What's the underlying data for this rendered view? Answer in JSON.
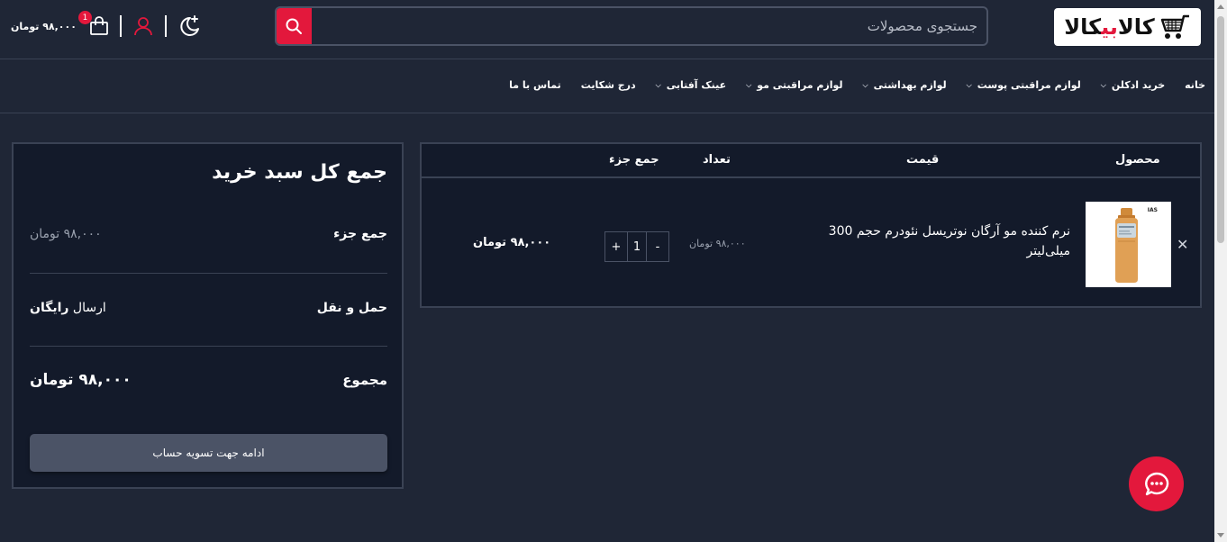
{
  "header": {
    "logo": {
      "part1": "کالا",
      "part2": "بی",
      "part3": "کالا"
    },
    "search_placeholder": "جستجوی محصولات",
    "cart_amount": "۹۸,۰۰۰ تومان",
    "cart_count": "1",
    "icons": [
      "search-icon",
      "shopping-bag-icon",
      "user-icon",
      "dark-mode-icon"
    ]
  },
  "nav": {
    "items": [
      {
        "label": "خانه",
        "dropdown": false
      },
      {
        "label": "خرید ادکلن",
        "dropdown": true
      },
      {
        "label": "لوازم مراقبتی پوست",
        "dropdown": true
      },
      {
        "label": "لوازم بهداشتی",
        "dropdown": true
      },
      {
        "label": "لوازم مراقبتی مو",
        "dropdown": true
      },
      {
        "label": "عینک آفتابی",
        "dropdown": true
      },
      {
        "label": "درج شکایت",
        "dropdown": false
      },
      {
        "label": "تماس با ما",
        "dropdown": false
      }
    ]
  },
  "cart": {
    "headers": {
      "product": "محصول",
      "price": "قیمت",
      "quantity": "تعداد",
      "subtotal": "جمع جزء"
    },
    "items": [
      {
        "name": "نرم کننده مو آرگان نوتریسل نئودرم حجم 300 میلی‌لیتر",
        "price": "۹۸,۰۰۰ تومان",
        "quantity": "1",
        "subtotal": "۹۸,۰۰۰ تومان",
        "minus": "-",
        "plus": "+"
      }
    ]
  },
  "totals": {
    "title": "جمع کل سبد خرید",
    "subtotal_label": "جمع جزء",
    "subtotal_value": "۹۸,۰۰۰ تومان",
    "shipping_label": "حمل و نقل",
    "shipping_prefix": "ارسال",
    "shipping_value": "رایگان",
    "total_label": "مجموع",
    "total_value": "۹۸,۰۰۰ تومان",
    "checkout_label": "ادامه جهت تسویه حساب"
  },
  "colors": {
    "accent": "#e3183c",
    "background": "#1f2636",
    "panel": "#131a2a",
    "border": "#3a4254"
  }
}
